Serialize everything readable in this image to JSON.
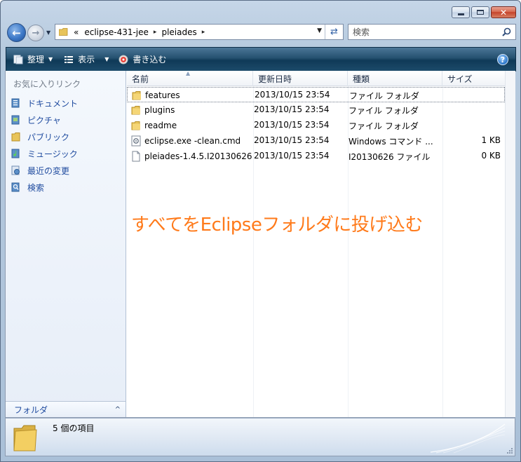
{
  "window": {
    "caption_buttons": [
      "minimize",
      "maximize",
      "close"
    ],
    "close_glyph": "✕"
  },
  "address_bar": {
    "overflow_chevron": "«",
    "crumbs": [
      "eclipse-431-jee",
      "pleiades"
    ],
    "separator": "▸"
  },
  "search": {
    "placeholder": "検索",
    "icon": "magnifier-icon"
  },
  "toolbar": {
    "organize_label": "整理",
    "views_label": "表示",
    "burn_label": "書き込む",
    "help_label": "?"
  },
  "nav_pane": {
    "title": "お気に入りリンク",
    "items": [
      {
        "label": "ドキュメント",
        "icon": "documents-icon"
      },
      {
        "label": "ピクチャ",
        "icon": "pictures-icon"
      },
      {
        "label": "パブリック",
        "icon": "public-folder-icon"
      },
      {
        "label": "ミュージック",
        "icon": "music-icon"
      },
      {
        "label": "最近の変更",
        "icon": "recent-changes-icon"
      },
      {
        "label": "検索",
        "icon": "search-folder-icon"
      }
    ],
    "folders_label": "フォルダ",
    "folders_caret": "^"
  },
  "file_list": {
    "columns": [
      "名前",
      "更新日時",
      "種類",
      "サイズ"
    ],
    "rows": [
      {
        "name": "features",
        "modified": "2013/10/15 23:54",
        "type": "ファイル フォルダ",
        "size": "",
        "icon": "folder-icon"
      },
      {
        "name": "plugins",
        "modified": "2013/10/15 23:54",
        "type": "ファイル フォルダ",
        "size": "",
        "icon": "folder-icon"
      },
      {
        "name": "readme",
        "modified": "2013/10/15 23:54",
        "type": "ファイル フォルダ",
        "size": "",
        "icon": "folder-icon"
      },
      {
        "name": "eclipse.exe -clean.cmd",
        "modified": "2013/10/15 23:54",
        "type": "Windows コマンド ...",
        "size": "1 KB",
        "icon": "cmd-file-icon"
      },
      {
        "name": "pleiades-1.4.5.I20130626",
        "modified": "2013/10/15 23:54",
        "type": "I20130626 ファイル",
        "size": "0 KB",
        "icon": "generic-file-icon"
      }
    ]
  },
  "annotation": {
    "text": "すべてをEclipseフォルダに投げ込む",
    "color": "#ff7a1a"
  },
  "details_pane": {
    "summary": "5 個の項目"
  }
}
